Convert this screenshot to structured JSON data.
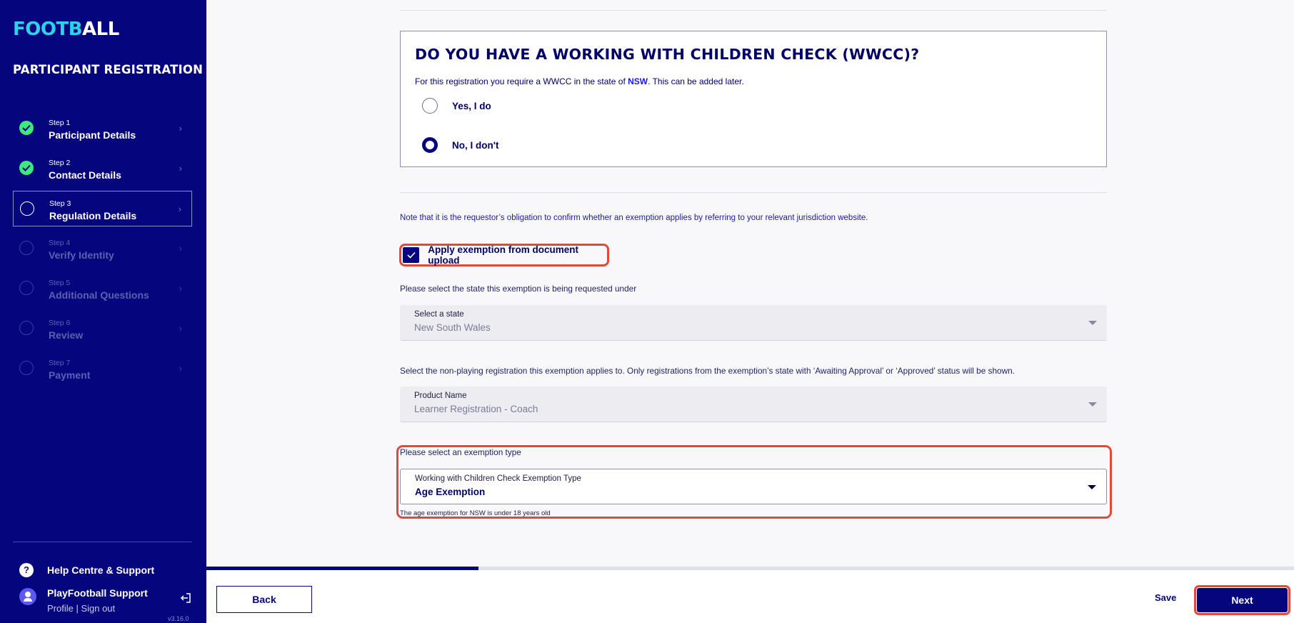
{
  "sidebar": {
    "logo_a": "FOOTB",
    "logo_b": "ALL",
    "title": "PARTICIPANT REGISTRATION",
    "steps": [
      {
        "num": "Step 1",
        "name": "Participant Details",
        "state": "done"
      },
      {
        "num": "Step 2",
        "name": "Contact Details",
        "state": "done"
      },
      {
        "num": "Step 3",
        "name": "Regulation Details",
        "state": "active"
      },
      {
        "num": "Step 4",
        "name": "Verify Identity",
        "state": "future"
      },
      {
        "num": "Step 5",
        "name": "Additional Questions",
        "state": "future"
      },
      {
        "num": "Step 6",
        "name": "Review",
        "state": "future"
      },
      {
        "num": "Step 7",
        "name": "Payment",
        "state": "future"
      }
    ],
    "help": "Help Centre & Support",
    "user_name": "PlayFootball Support",
    "user_links": "Profile | Sign out",
    "version": "v3.16.0"
  },
  "wwcc": {
    "heading": "DO YOU HAVE A WORKING WITH CHILDREN CHECK (WWCC)?",
    "sub_pre": "For this registration you require a WWCC in the state of ",
    "sub_state": "NSW",
    "sub_post": ". This can be added later.",
    "option_yes": "Yes, I do",
    "option_no": "No, I don't",
    "selected": "no"
  },
  "exemption": {
    "note": "Note that it is the requestor’s obligation to confirm whether an exemption applies by referring to your relevant jurisdiction website.",
    "checkbox_label": "Apply exemption from document upload",
    "checkbox_checked": true,
    "state_question": "Please select the state this exemption is being requested under",
    "state_select_label": "Select a state",
    "state_select_value": "New South Wales",
    "product_question": "Select the non-playing registration this exemption applies to. Only registrations from the exemption’s state with ‘Awaiting Approval’ or ‘Approved’ status will be shown.",
    "product_select_label": "Product Name",
    "product_select_value": "Learner Registration - Coach",
    "type_question": "Please select an exemption type",
    "type_select_label": "Working with Children Check Exemption Type",
    "type_select_value": "Age Exemption",
    "type_hint": "The age exemption for NSW is under 18 years old"
  },
  "footer": {
    "back": "Back",
    "save": "Save",
    "next": "Next",
    "progress": 0.25
  },
  "colors": {
    "brand": "#05057e",
    "accent": "#2ed2e8",
    "success": "#3ee87a",
    "highlight": "#e04a3b"
  }
}
